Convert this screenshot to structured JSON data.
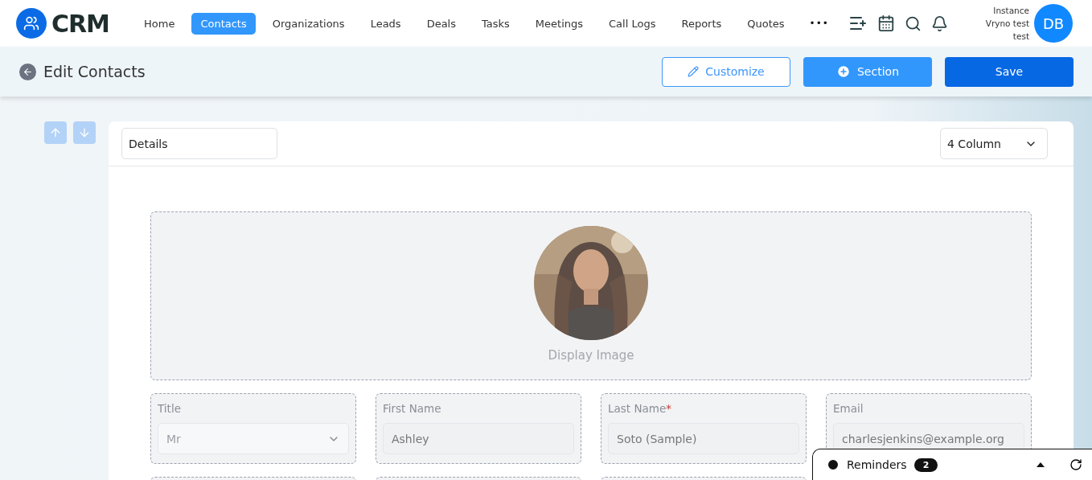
{
  "logo": {
    "text": "CRM"
  },
  "nav": [
    {
      "label": "Home",
      "selected": false
    },
    {
      "label": "Contacts",
      "selected": true
    },
    {
      "label": "Organizations",
      "selected": false
    },
    {
      "label": "Leads",
      "selected": false
    },
    {
      "label": "Deals",
      "selected": false
    },
    {
      "label": "Tasks",
      "selected": false
    },
    {
      "label": "Meetings",
      "selected": false
    },
    {
      "label": "Call Logs",
      "selected": false
    },
    {
      "label": "Reports",
      "selected": false
    },
    {
      "label": "Quotes",
      "selected": false
    }
  ],
  "more": "•••",
  "user": {
    "lines": [
      "Instance",
      "Vryno test",
      "test"
    ],
    "initials": "DB"
  },
  "page": {
    "title": "Edit Contacts",
    "buttons": [
      {
        "kind": "outline",
        "label": "Customize"
      },
      {
        "kind": "add",
        "label": "Section"
      },
      {
        "kind": "primary",
        "label": "Save"
      }
    ]
  },
  "section": {
    "name": "Details",
    "required_marker": "*",
    "columns": "4 Column",
    "image_label": "Display Image",
    "fields": [
      {
        "label": "Title",
        "kind": "select",
        "value": "Mr",
        "required": false
      },
      {
        "label": "First Name",
        "kind": "text",
        "value": "Ashley",
        "required": false
      },
      {
        "label": "Last Name",
        "kind": "text",
        "value": "Soto (Sample)",
        "required": true
      },
      {
        "label": "Email",
        "kind": "text",
        "value": "charlesjenkins@example.org",
        "required": false
      }
    ]
  },
  "reminders": {
    "label": "Reminders",
    "count": "2"
  }
}
